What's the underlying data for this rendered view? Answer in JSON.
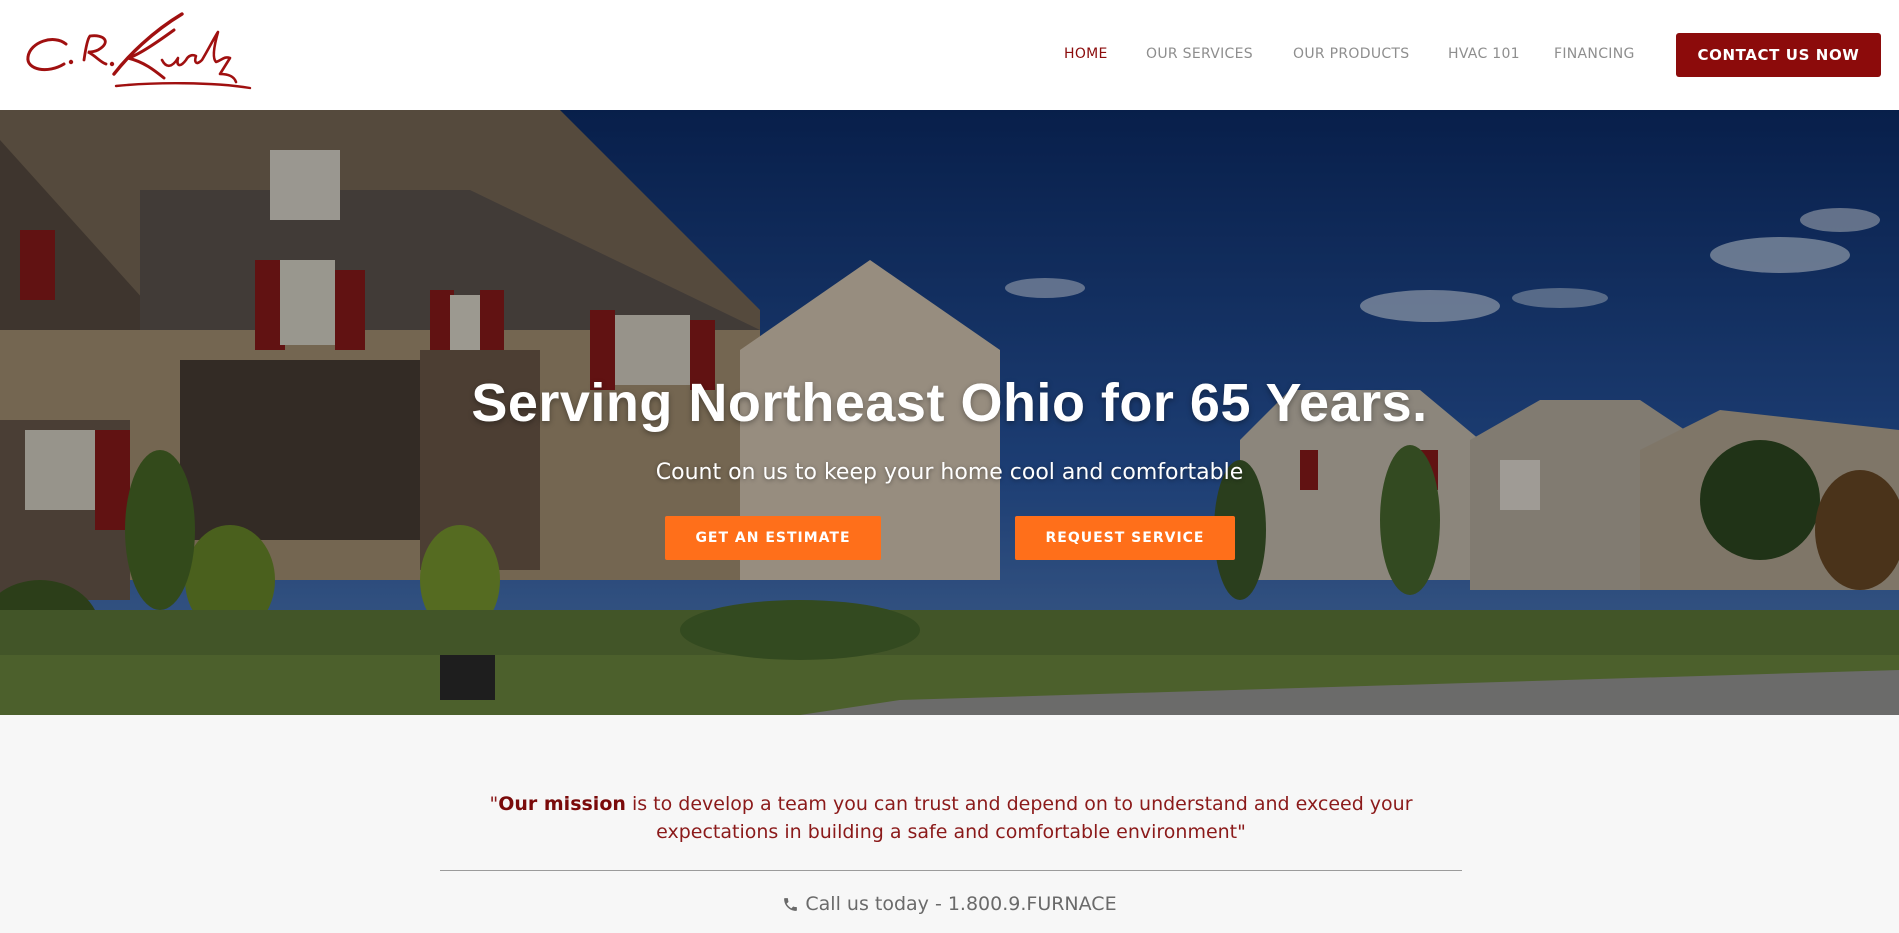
{
  "brand": {
    "logo_text": "C.R. Kurtz",
    "accent_color": "#8c0b0b"
  },
  "nav": {
    "items": [
      {
        "label": "HOME",
        "active": true
      },
      {
        "label": "OUR SERVICES",
        "active": false
      },
      {
        "label": "OUR PRODUCTS",
        "active": false
      },
      {
        "label": "HVAC 101",
        "active": false
      },
      {
        "label": "FINANCING",
        "active": false
      }
    ],
    "cta_label": "CONTACT US NOW"
  },
  "hero": {
    "title": "Serving Northeast Ohio for 65 Years.",
    "subtitle": "Count on us to keep your home cool and comfortable",
    "buttons": {
      "estimate": "GET AN ESTIMATE",
      "service": "REQUEST SERVICE"
    },
    "button_color": "#ff6f1a"
  },
  "mission": {
    "open_quote": "\"",
    "emphasis": "Our mission",
    "text": " is to develop a team you can trust and depend on to understand and exceed your expectations in building a safe and comfortable environment\""
  },
  "call": {
    "icon": "phone-icon",
    "text": "Call us today - 1.800.9.FURNACE"
  }
}
